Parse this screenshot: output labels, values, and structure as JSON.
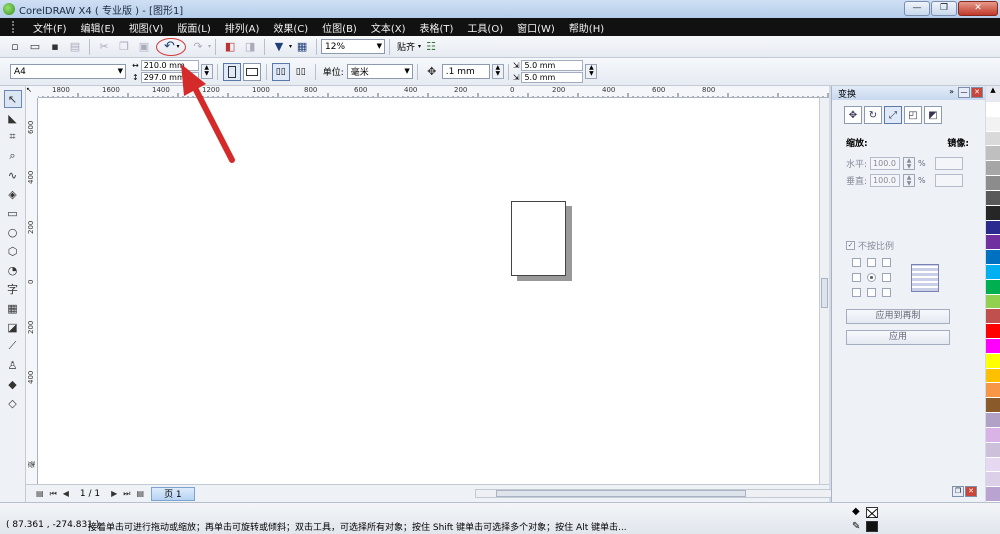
{
  "window": {
    "title": "CorelDRAW X4 ( 专业版 ) - [图形1]",
    "min": "—",
    "max": "❐",
    "close": "✕"
  },
  "menu": [
    "文件(F)",
    "编辑(E)",
    "视图(V)",
    "版面(L)",
    "排列(A)",
    "效果(C)",
    "位图(B)",
    "文本(X)",
    "表格(T)",
    "工具(O)",
    "窗口(W)",
    "帮助(H)"
  ],
  "toolbar1": {
    "zoom": "12%",
    "snap": "贴齐"
  },
  "toolbar2": {
    "paper": "A4",
    "width": "210.0 mm",
    "height": "297.0 mm",
    "unit_label": "单位:",
    "unit": "毫米",
    "nudge": ".1 mm",
    "dup_x": "5.0 mm",
    "dup_y": "5.0 mm"
  },
  "ruler_h": [
    "1800",
    "1600",
    "1400",
    "1200",
    "1000",
    "800",
    "600",
    "400",
    "200",
    "0",
    "200",
    "400",
    "600",
    "800"
  ],
  "ruler_v": [
    "600",
    "400",
    "200",
    "0",
    "200",
    "400"
  ],
  "ruler_unit": "毫米",
  "pagebar": {
    "count": "1 / 1",
    "tab": "页 1"
  },
  "docker": {
    "title": "变换",
    "scale_label": "缩放:",
    "mirror_label": "镜像:",
    "h_label": "水平:",
    "h_value": "100.0",
    "v_label": "垂直:",
    "v_value": "100.0",
    "pct": "%",
    "nonprop": "不按比例",
    "apply_dup": "应用到再制",
    "apply": "应用"
  },
  "palette": [
    "#ffffff",
    "#f2f2f2",
    "#d9d9d9",
    "#bfbfbf",
    "#a6a6a6",
    "#8c8c8c",
    "#595959",
    "#262626",
    "#2b2b8f",
    "#7030a0",
    "#0070c0",
    "#00b0f0",
    "#00b050",
    "#92d050",
    "#c0504d",
    "#ff0000",
    "#ff00ff",
    "#ffff00",
    "#ffc000",
    "#f79646",
    "#8b5a2b",
    "#b2a1c7",
    "#d9b3e6",
    "#ccc0da",
    "#e5d8f0",
    "#dcd0e8",
    "#b9a3d0"
  ],
  "status": {
    "coords": "( 87.361 , -274.831 )",
    "hint": "接着单击可进行拖动或缩放；再单击可旋转或倾斜；双击工具，可选择所有对象；按住 Shift 键单击可选择多个对象；按住 Alt 键单击..."
  }
}
